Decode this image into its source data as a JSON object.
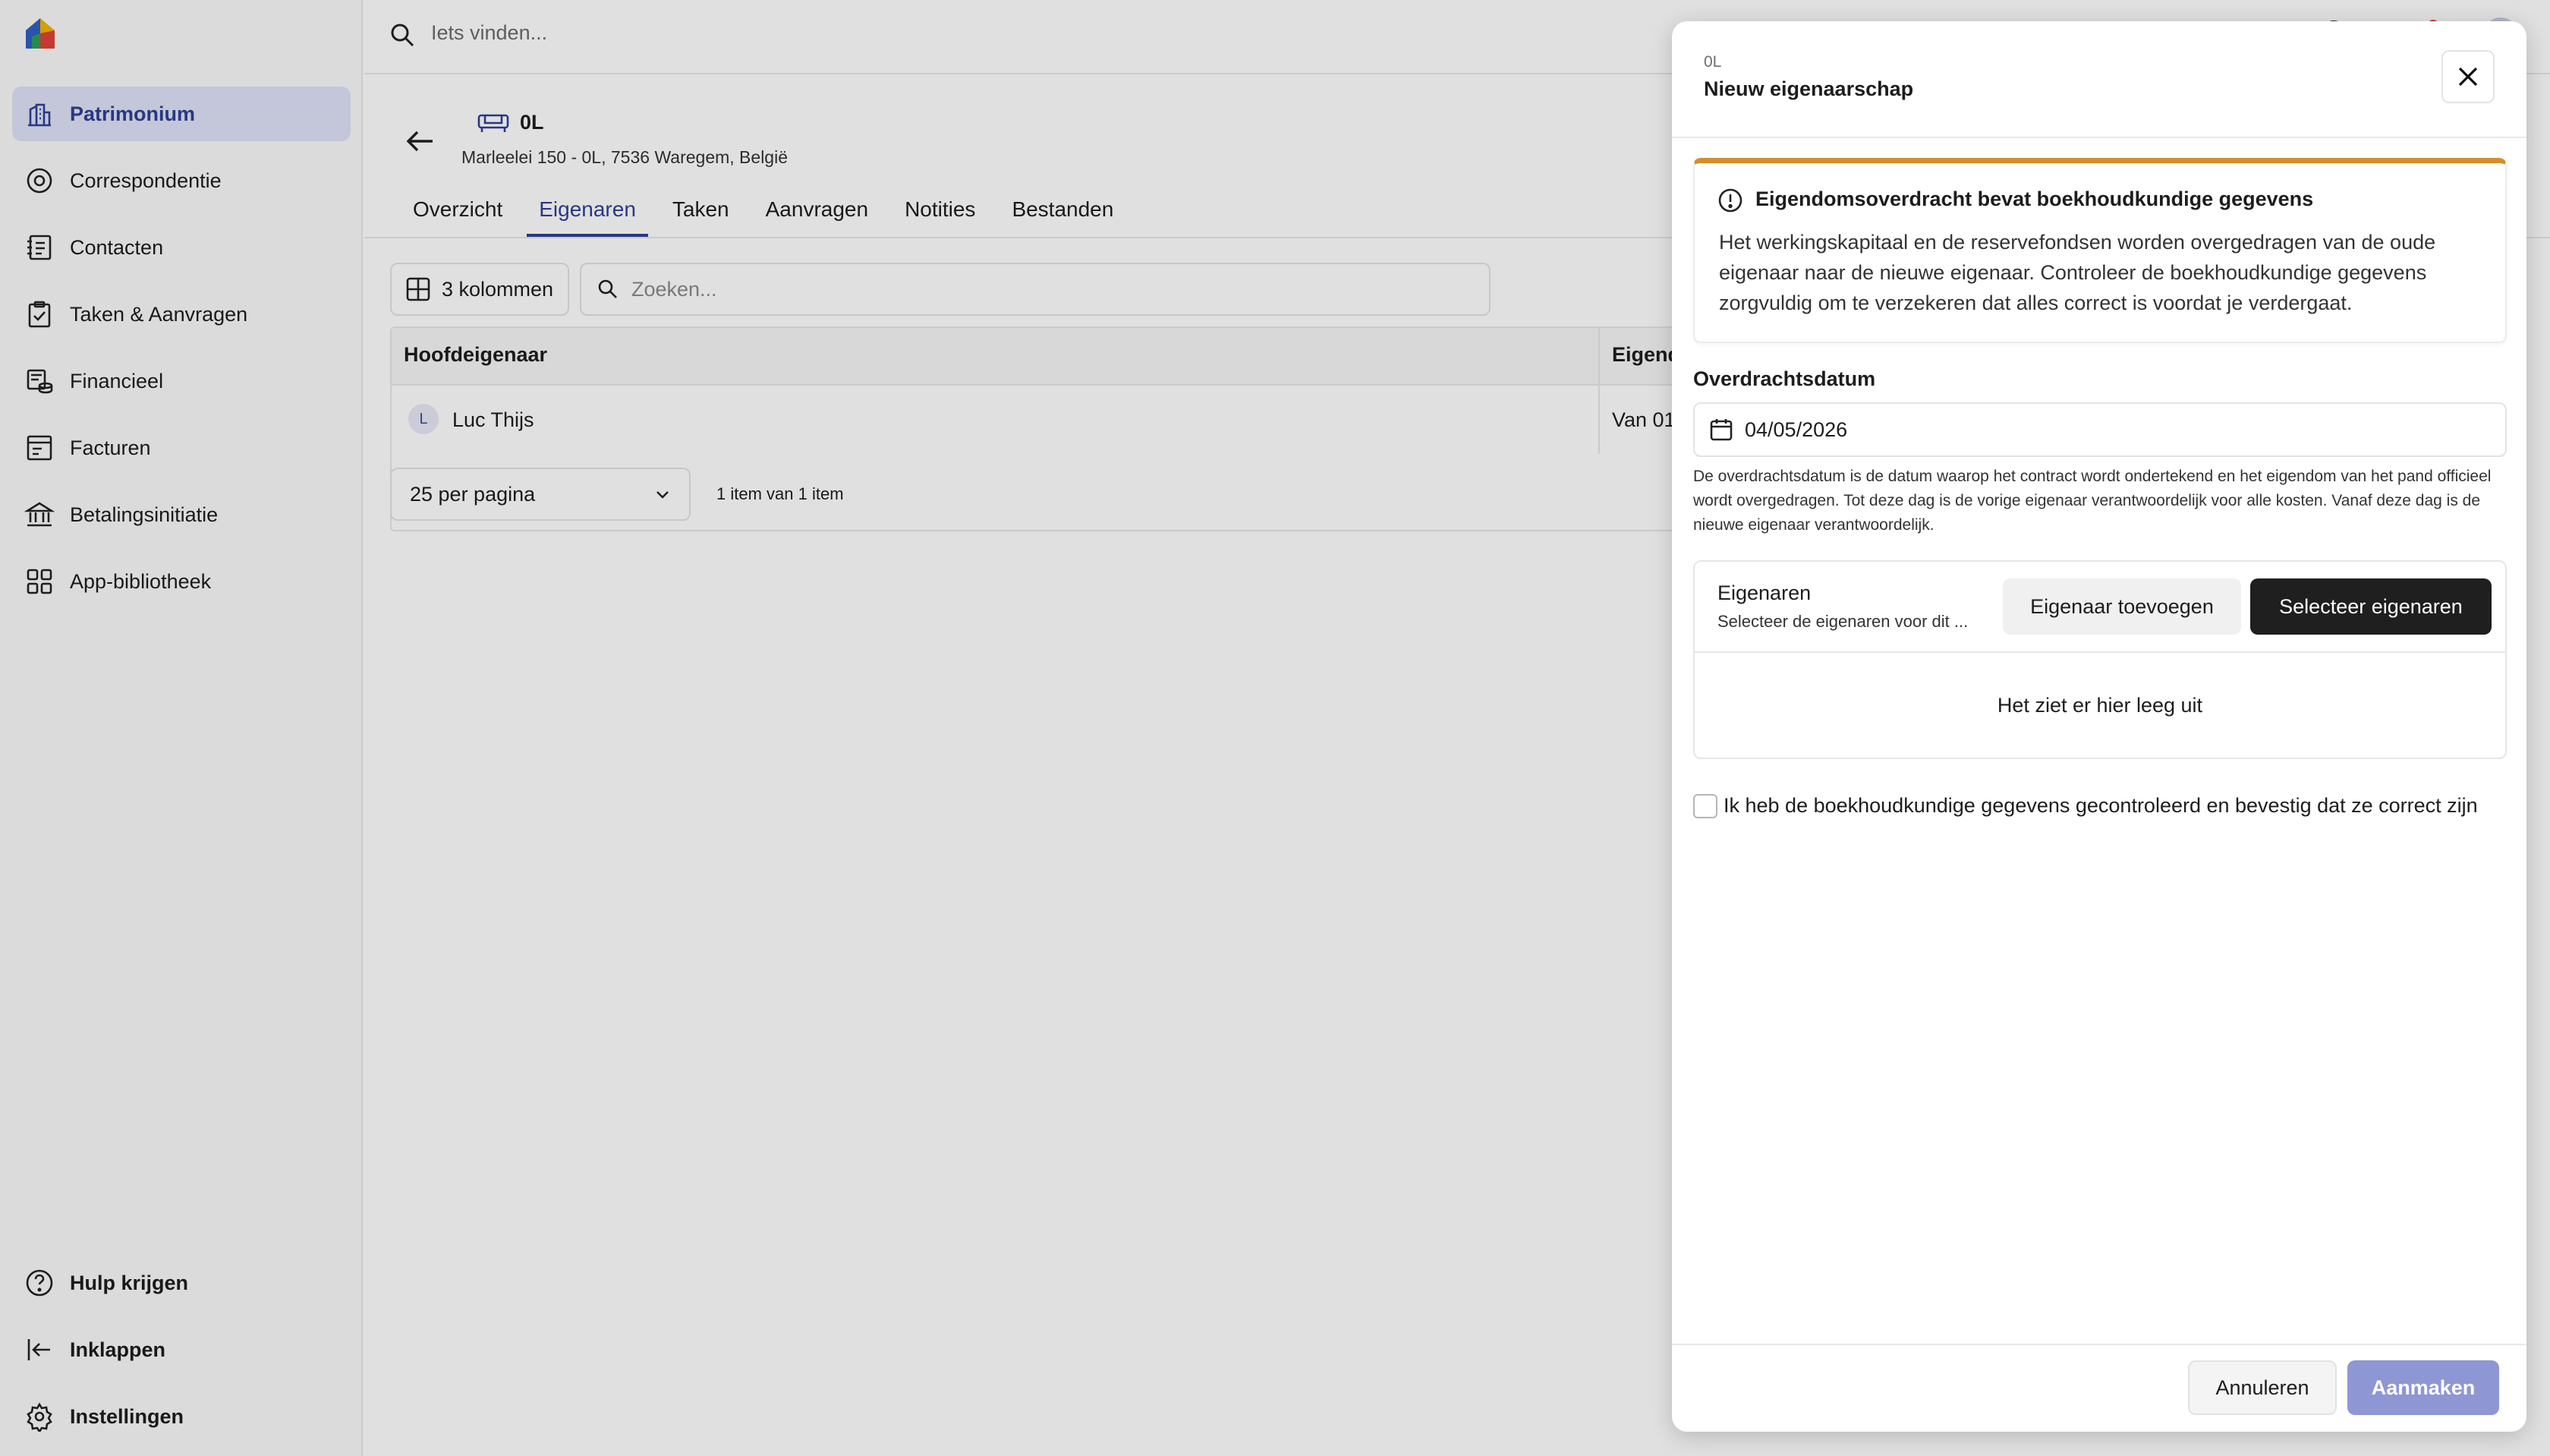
{
  "topbar": {
    "search_placeholder": "Iets vinden..."
  },
  "sidebar": {
    "items": [
      {
        "label": "Patrimonium",
        "icon": "building-icon"
      },
      {
        "label": "Correspondentie",
        "icon": "mail-at-icon"
      },
      {
        "label": "Contacten",
        "icon": "contacts-icon"
      },
      {
        "label": "Taken & Aanvragen",
        "icon": "clipboard-check-icon"
      },
      {
        "label": "Financieel",
        "icon": "coins-icon"
      },
      {
        "label": "Facturen",
        "icon": "invoice-icon"
      },
      {
        "label": "Betalingsinitiatie",
        "icon": "bank-icon"
      },
      {
        "label": "App-bibliotheek",
        "icon": "apps-icon"
      }
    ],
    "bottom": [
      {
        "label": "Hulp krijgen",
        "icon": "help-icon"
      },
      {
        "label": "Inklappen",
        "icon": "collapse-icon"
      },
      {
        "label": "Instellingen",
        "icon": "settings-icon"
      }
    ]
  },
  "property": {
    "name": "0L",
    "address": "Marleelei 150 - 0L, 7536 Waregem, België"
  },
  "tabs": [
    "Overzicht",
    "Eigenaren",
    "Taken",
    "Aanvragen",
    "Notities",
    "Bestanden"
  ],
  "toolbar": {
    "columns_label": "3 kolommen",
    "search_placeholder": "Zoeken..."
  },
  "table": {
    "headers": [
      "Hoofdeigenaar",
      "Eigend"
    ],
    "rows": [
      {
        "initial": "L",
        "name": "Luc Thijs",
        "period": "Van 01"
      }
    ]
  },
  "pagination": {
    "per_page": "25 per pagina",
    "count": "1 item van 1 item"
  },
  "drawer": {
    "subtitle": "0L",
    "title": "Nieuw eigenaarschap",
    "warning": {
      "title": "Eigendomsoverdracht bevat boekhoudkundige gegevens",
      "text": "Het werkingskapitaal en de reservefondsen worden overgedragen van de oude eigenaar naar de nieuwe eigenaar. Controleer de boekhoudkundige gegevens zorgvuldig om te verzekeren dat alles correct is voordat je verdergaat."
    },
    "date_label": "Overdrachtsdatum",
    "date_value": "04/05/2026",
    "date_help": "De overdrachtsdatum is de datum waarop het contract wordt ondertekend en het eigendom van het pand officieel wordt overgedragen. Tot deze dag is de vorige eigenaar verantwoordelijk voor alle kosten. Vanaf deze dag is de nieuwe eigenaar verantwoordelijk.",
    "owners_title": "Eigenaren",
    "owners_sub": "Selecteer de eigenaren voor dit ...",
    "add_owner": "Eigenaar toevoegen",
    "select_owners": "Selecteer eigenaren",
    "empty": "Het ziet er hier leeg uit",
    "confirm_label": "Ik heb de boekhoudkundige gegevens gecontroleerd en bevestig dat ze correct zijn",
    "cancel": "Annuleren",
    "create": "Aanmaken"
  },
  "colors": {
    "accent": "#2f3f95",
    "warning": "#d38f2b",
    "primary_button": "#1f1f1f",
    "create_disabled": "#8e96d4"
  }
}
